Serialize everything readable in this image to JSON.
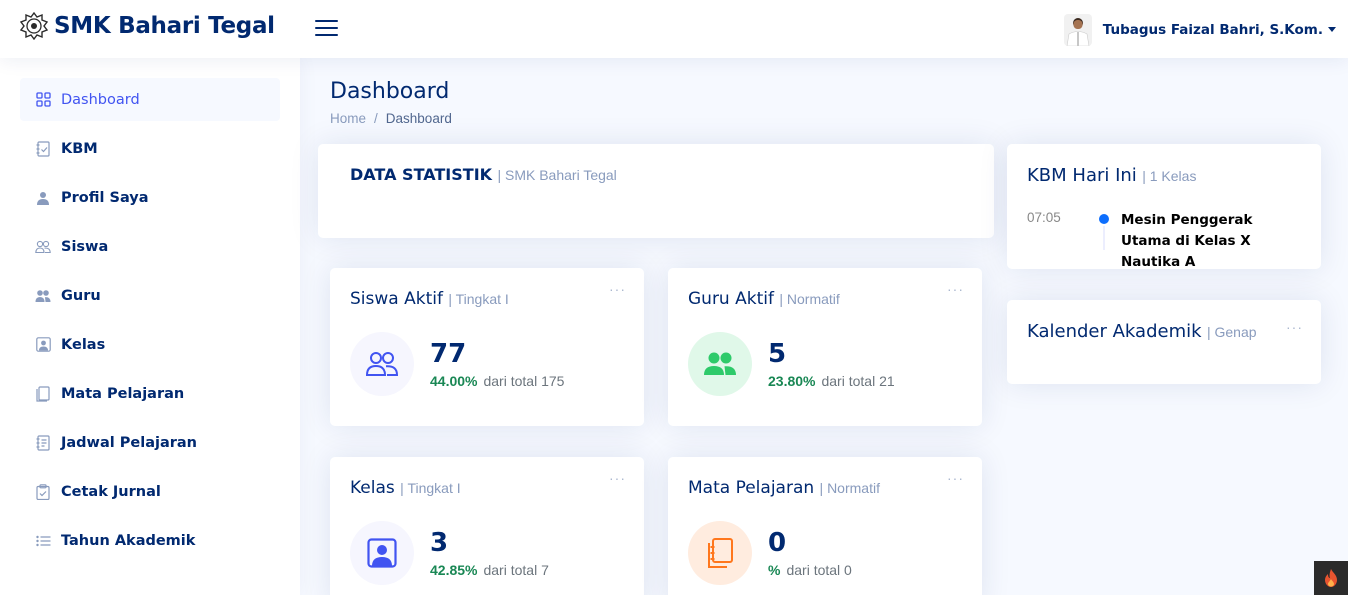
{
  "header": {
    "logo_text": "SMK Bahari Tegal",
    "profile_name": "Tubagus Faizal Bahri, S.Kom."
  },
  "sidebar": {
    "items": [
      {
        "label": "Dashboard",
        "icon": "grid-icon",
        "active": true
      },
      {
        "label": "KBM",
        "icon": "journal-check-icon"
      },
      {
        "label": "Profil Saya",
        "icon": "person-icon"
      },
      {
        "label": "Siswa",
        "icon": "people-icon"
      },
      {
        "label": "Guru",
        "icon": "people-fill-icon"
      },
      {
        "label": "Kelas",
        "icon": "person-square-icon"
      },
      {
        "label": "Mata Pelajaran",
        "icon": "journals-icon"
      },
      {
        "label": "Jadwal Pelajaran",
        "icon": "journal-text-icon"
      },
      {
        "label": "Cetak Jurnal",
        "icon": "clipboard-check-icon"
      },
      {
        "label": "Tahun Akademik",
        "icon": "list-icon"
      }
    ]
  },
  "page": {
    "title": "Dashboard",
    "breadcrumb": {
      "home": "Home",
      "separator": "/",
      "current": "Dashboard"
    }
  },
  "statistik": {
    "title": "DATA STATISTIK",
    "subtitle": "| SMK Bahari Tegal"
  },
  "cards": {
    "siswa": {
      "title": "Siswa Aktif",
      "subtitle": "| Tingkat I",
      "value": "77",
      "percent": "44.00%",
      "meta": "dari total 175",
      "icon_color": "#4154f1",
      "icon_bg": "#f6f6fe"
    },
    "guru": {
      "title": "Guru Aktif",
      "subtitle": "| Normatif",
      "value": "5",
      "percent": "23.80%",
      "meta": "dari total 21",
      "icon_color": "#2eca6a",
      "icon_bg": "#e0f8e9"
    },
    "kelas": {
      "title": "Kelas",
      "subtitle": "| Tingkat I",
      "value": "3",
      "percent": "42.85%",
      "meta": "dari total 7",
      "icon_color": "#4154f1",
      "icon_bg": "#f6f6fe"
    },
    "mapel": {
      "title": "Mata Pelajaran",
      "subtitle": "| Normatif",
      "value": "0",
      "percent": "%",
      "meta": "dari total 0",
      "icon_color": "#ff771d",
      "icon_bg": "#ffecdf"
    }
  },
  "more_label": "···",
  "kbm": {
    "title": "KBM Hari Ini",
    "subtitle": "| 1 Kelas",
    "activities": [
      {
        "time": "07:05",
        "text": "Mesin Penggerak Utama di Kelas X Nautika A"
      }
    ]
  },
  "kalender": {
    "title": "Kalender Akademik",
    "subtitle": "| Genap"
  }
}
